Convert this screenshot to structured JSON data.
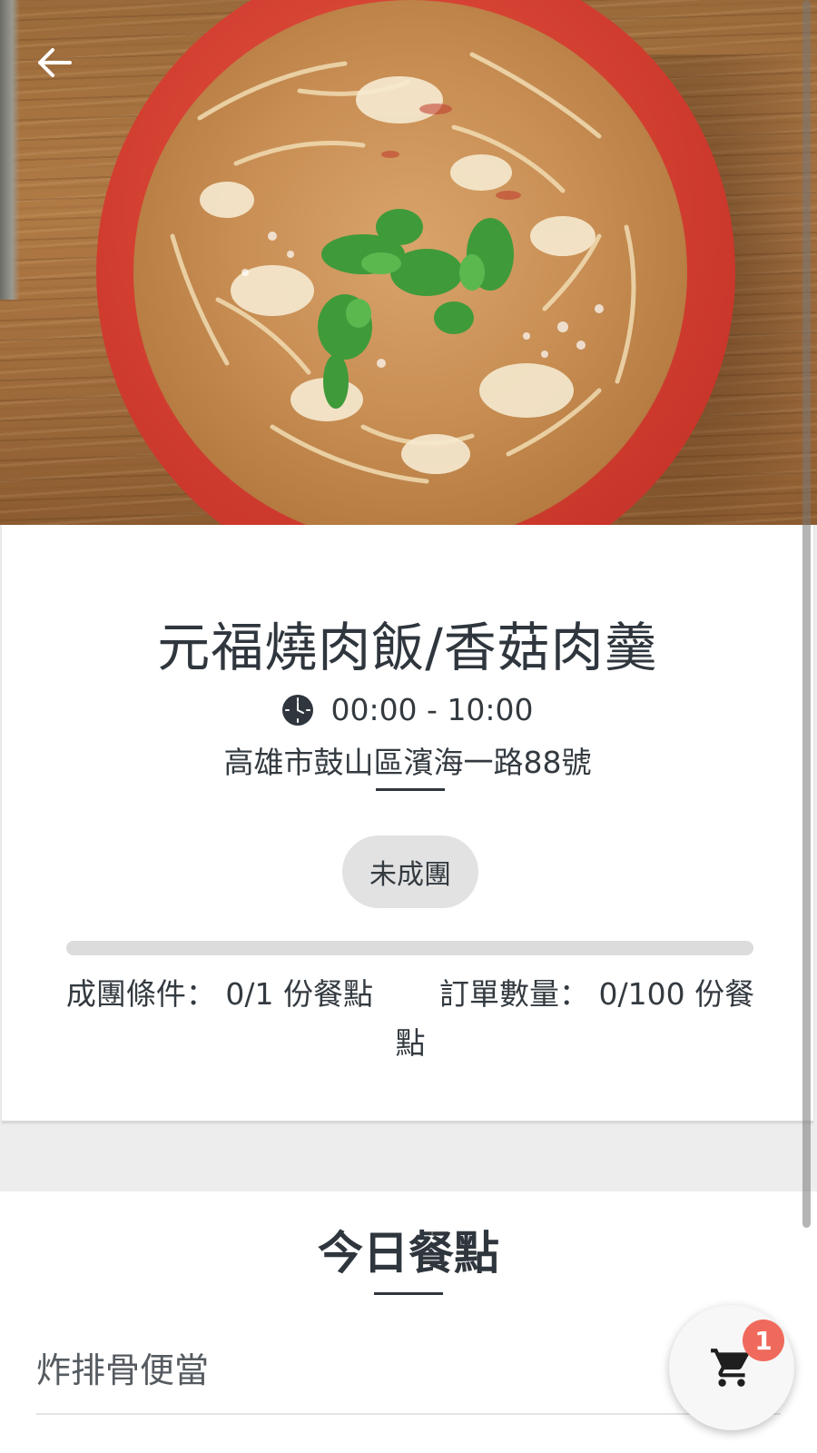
{
  "hero": {
    "image_desc_icon": "soup-bowl-photo",
    "back_icon": "arrow-left-icon"
  },
  "shop": {
    "name": "元福燒肉飯/香菇肉羹",
    "hours": "00:00 - 10:00",
    "address": "高雄市鼓山區濱海一路88號",
    "clock_icon": "clock-icon"
  },
  "group": {
    "status": "未成團",
    "progress_fraction": 0,
    "condition_label": "成團條件：",
    "condition_value": "0/1 份餐點",
    "orders_label": "訂單數量：",
    "orders_value": "0/100 份餐點"
  },
  "menu": {
    "title": "今日餐點",
    "items": [
      {
        "name": "炸排骨便當"
      }
    ]
  },
  "cart": {
    "icon": "cart-icon",
    "count": "1"
  },
  "colors": {
    "accent": "#ef6a5c",
    "text_dark": "#2f363d",
    "card_bg": "#ffffff",
    "page_bg": "#ededed"
  }
}
